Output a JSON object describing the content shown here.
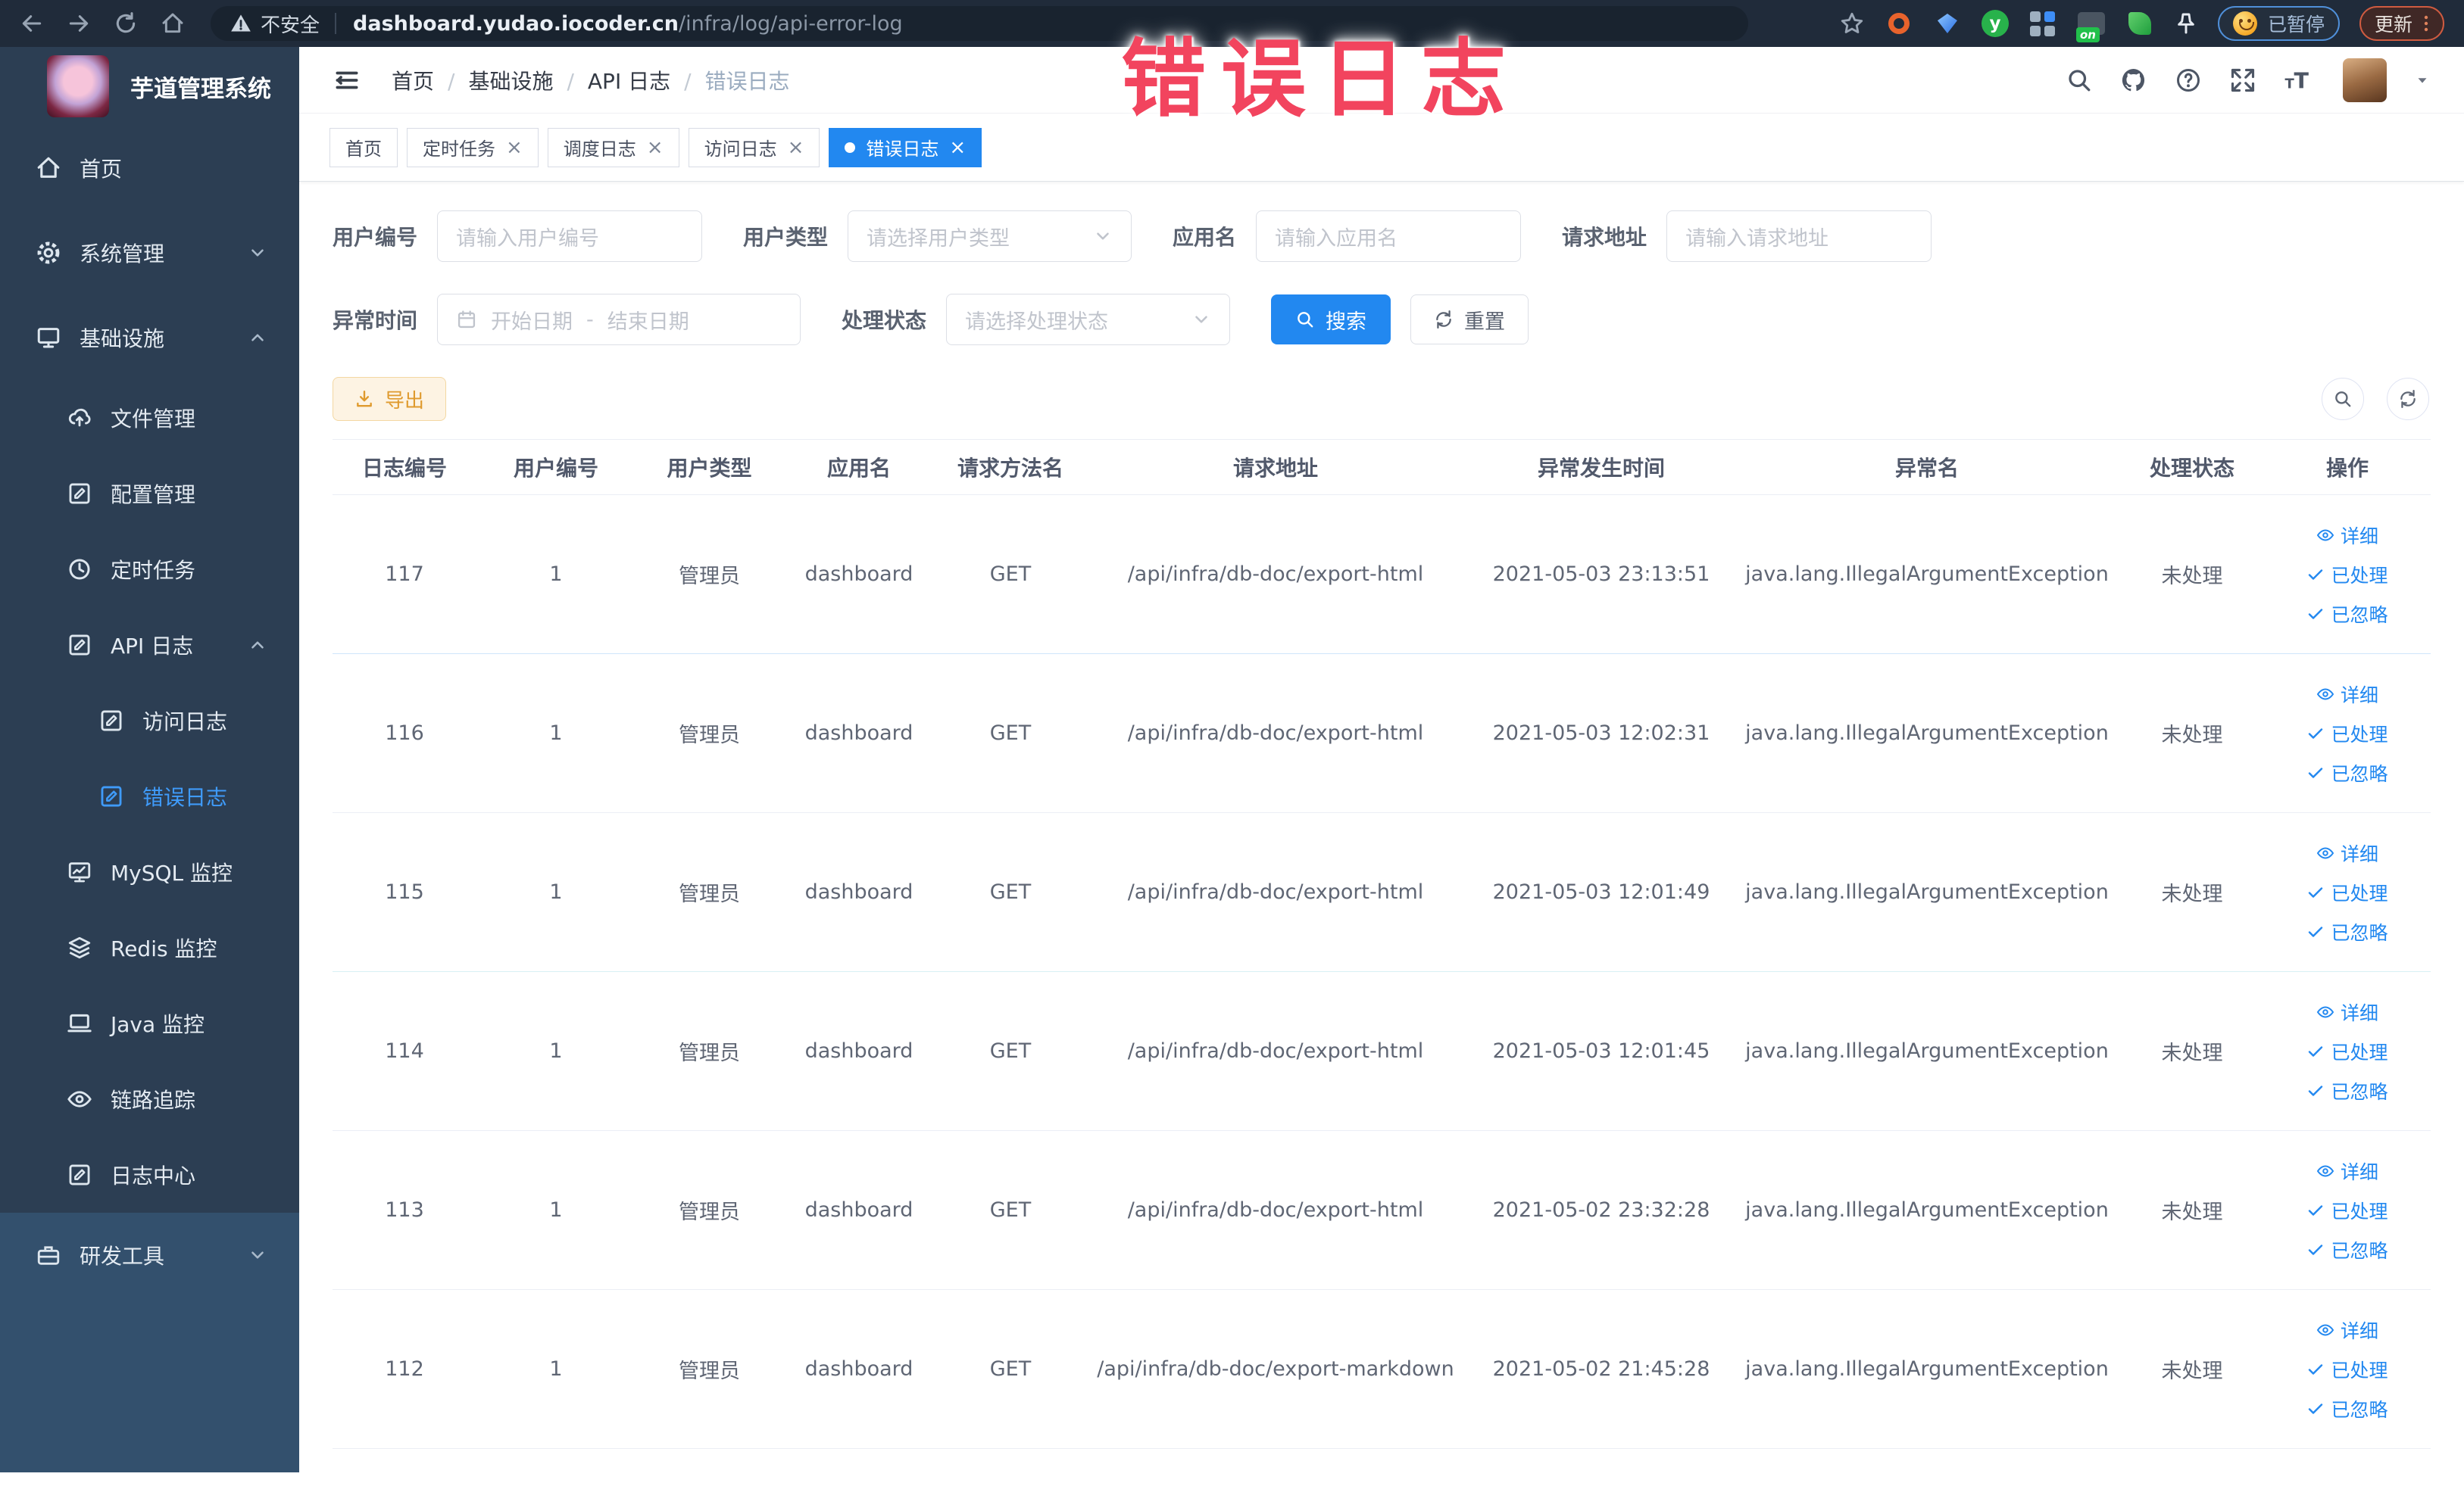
{
  "browser": {
    "security_warning": "不安全",
    "url_host": "dashboard.yudao.iocoder.cn",
    "url_path": "/infra/log/api-error-log",
    "extension_green_letter": "y",
    "paused_badge": "已暂停",
    "update_button": "更新"
  },
  "annotation": {
    "title": "错误日志",
    "color": "#f2445e"
  },
  "sidebar": {
    "logo_title": "芋道管理系统",
    "items": [
      {
        "label": "首页",
        "icon": "i-home",
        "level": 1
      },
      {
        "label": "系统管理",
        "icon": "i-gear",
        "level": 1,
        "chevron_down": true
      },
      {
        "label": "基础设施",
        "icon": "i-screen",
        "level": 1,
        "chevron_up": true
      },
      {
        "label": "文件管理",
        "icon": "i-cloud",
        "level": 2
      },
      {
        "label": "配置管理",
        "icon": "i-editsq",
        "level": 2
      },
      {
        "label": "定时任务",
        "icon": "i-clock",
        "level": 2
      },
      {
        "label": "API 日志",
        "icon": "i-editsq",
        "level": 2,
        "chevron_up": true
      },
      {
        "label": "访问日志",
        "icon": "i-editsq",
        "level": 3
      },
      {
        "label": "错误日志",
        "icon": "i-editsq",
        "level": 3,
        "active": true
      },
      {
        "label": "MySQL 监控",
        "icon": "i-chart",
        "level": 2
      },
      {
        "label": "Redis 监控",
        "icon": "i-layers",
        "level": 2
      },
      {
        "label": "Java 监控",
        "icon": "i-laptop",
        "level": 2
      },
      {
        "label": "链路追踪",
        "icon": "i-eye",
        "level": 2
      },
      {
        "label": "日志中心",
        "icon": "i-editsq",
        "level": 2
      },
      {
        "label": "研发工具",
        "icon": "i-briefcase",
        "level": 1,
        "chevron_down": true
      }
    ]
  },
  "breadcrumb": {
    "items": [
      "首页",
      "基础设施",
      "API 日志",
      "错误日志"
    ]
  },
  "tabs": [
    {
      "label": "首页"
    },
    {
      "label": "定时任务",
      "closable": true
    },
    {
      "label": "调度日志",
      "closable": true
    },
    {
      "label": "访问日志",
      "closable": true
    },
    {
      "label": "错误日志",
      "closable": true,
      "active": true,
      "dot": true
    }
  ],
  "filters": {
    "user_id": {
      "label": "用户编号",
      "placeholder": "请输入用户编号"
    },
    "user_type": {
      "label": "用户类型",
      "placeholder": "请选择用户类型"
    },
    "app_name": {
      "label": "应用名",
      "placeholder": "请输入应用名"
    },
    "request_url": {
      "label": "请求地址",
      "placeholder": "请输入请求地址"
    },
    "exception_time": {
      "label": "异常时间",
      "start_placeholder": "开始日期",
      "separator": "-",
      "end_placeholder": "结束日期"
    },
    "process_status": {
      "label": "处理状态",
      "placeholder": "请选择处理状态"
    },
    "search_button": "搜索",
    "reset_button": "重置"
  },
  "toolbar": {
    "export_button": "导出"
  },
  "table": {
    "columns": [
      "日志编号",
      "用户编号",
      "用户类型",
      "应用名",
      "请求方法名",
      "请求地址",
      "异常发生时间",
      "异常名",
      "处理状态",
      "操作"
    ],
    "actions": [
      "详细",
      "已处理",
      "已忽略"
    ],
    "rows": [
      {
        "id": "117",
        "user_id": "1",
        "user_type": "管理员",
        "app": "dashboard",
        "method": "GET",
        "url": "/api/infra/db-doc/export-html",
        "time": "2021-05-03 23:13:51",
        "exception": "java.lang.IllegalArgumentException",
        "status": "未处理"
      },
      {
        "id": "116",
        "user_id": "1",
        "user_type": "管理员",
        "app": "dashboard",
        "method": "GET",
        "url": "/api/infra/db-doc/export-html",
        "time": "2021-05-03 12:02:31",
        "exception": "java.lang.IllegalArgumentException",
        "status": "未处理"
      },
      {
        "id": "115",
        "user_id": "1",
        "user_type": "管理员",
        "app": "dashboard",
        "method": "GET",
        "url": "/api/infra/db-doc/export-html",
        "time": "2021-05-03 12:01:49",
        "exception": "java.lang.IllegalArgumentException",
        "status": "未处理"
      },
      {
        "id": "114",
        "user_id": "1",
        "user_type": "管理员",
        "app": "dashboard",
        "method": "GET",
        "url": "/api/infra/db-doc/export-html",
        "time": "2021-05-03 12:01:45",
        "exception": "java.lang.IllegalArgumentException",
        "status": "未处理"
      },
      {
        "id": "113",
        "user_id": "1",
        "user_type": "管理员",
        "app": "dashboard",
        "method": "GET",
        "url": "/api/infra/db-doc/export-html",
        "time": "2021-05-02 23:32:28",
        "exception": "java.lang.IllegalArgumentException",
        "status": "未处理"
      },
      {
        "id": "112",
        "user_id": "1",
        "user_type": "管理员",
        "app": "dashboard",
        "method": "GET",
        "url": "/api/infra/db-doc/export-markdown",
        "time": "2021-05-02 21:45:28",
        "exception": "java.lang.IllegalArgumentException",
        "status": "未处理"
      }
    ]
  }
}
